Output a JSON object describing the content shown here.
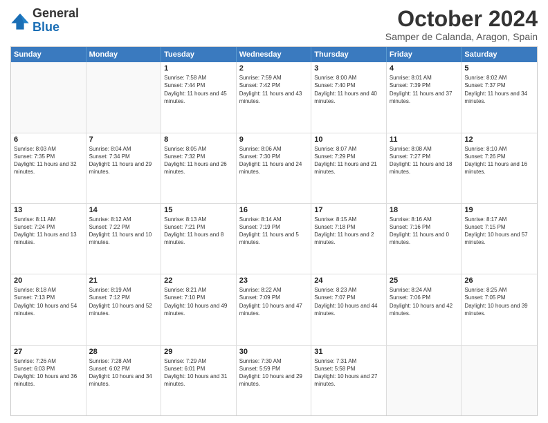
{
  "logo": {
    "general": "General",
    "blue": "Blue"
  },
  "title": "October 2024",
  "location": "Samper de Calanda, Aragon, Spain",
  "days_of_week": [
    "Sunday",
    "Monday",
    "Tuesday",
    "Wednesday",
    "Thursday",
    "Friday",
    "Saturday"
  ],
  "weeks": [
    [
      {
        "day": "",
        "info": ""
      },
      {
        "day": "",
        "info": ""
      },
      {
        "day": "1",
        "info": "Sunrise: 7:58 AM\nSunset: 7:44 PM\nDaylight: 11 hours and 45 minutes."
      },
      {
        "day": "2",
        "info": "Sunrise: 7:59 AM\nSunset: 7:42 PM\nDaylight: 11 hours and 43 minutes."
      },
      {
        "day": "3",
        "info": "Sunrise: 8:00 AM\nSunset: 7:40 PM\nDaylight: 11 hours and 40 minutes."
      },
      {
        "day": "4",
        "info": "Sunrise: 8:01 AM\nSunset: 7:39 PM\nDaylight: 11 hours and 37 minutes."
      },
      {
        "day": "5",
        "info": "Sunrise: 8:02 AM\nSunset: 7:37 PM\nDaylight: 11 hours and 34 minutes."
      }
    ],
    [
      {
        "day": "6",
        "info": "Sunrise: 8:03 AM\nSunset: 7:35 PM\nDaylight: 11 hours and 32 minutes."
      },
      {
        "day": "7",
        "info": "Sunrise: 8:04 AM\nSunset: 7:34 PM\nDaylight: 11 hours and 29 minutes."
      },
      {
        "day": "8",
        "info": "Sunrise: 8:05 AM\nSunset: 7:32 PM\nDaylight: 11 hours and 26 minutes."
      },
      {
        "day": "9",
        "info": "Sunrise: 8:06 AM\nSunset: 7:30 PM\nDaylight: 11 hours and 24 minutes."
      },
      {
        "day": "10",
        "info": "Sunrise: 8:07 AM\nSunset: 7:29 PM\nDaylight: 11 hours and 21 minutes."
      },
      {
        "day": "11",
        "info": "Sunrise: 8:08 AM\nSunset: 7:27 PM\nDaylight: 11 hours and 18 minutes."
      },
      {
        "day": "12",
        "info": "Sunrise: 8:10 AM\nSunset: 7:26 PM\nDaylight: 11 hours and 16 minutes."
      }
    ],
    [
      {
        "day": "13",
        "info": "Sunrise: 8:11 AM\nSunset: 7:24 PM\nDaylight: 11 hours and 13 minutes."
      },
      {
        "day": "14",
        "info": "Sunrise: 8:12 AM\nSunset: 7:22 PM\nDaylight: 11 hours and 10 minutes."
      },
      {
        "day": "15",
        "info": "Sunrise: 8:13 AM\nSunset: 7:21 PM\nDaylight: 11 hours and 8 minutes."
      },
      {
        "day": "16",
        "info": "Sunrise: 8:14 AM\nSunset: 7:19 PM\nDaylight: 11 hours and 5 minutes."
      },
      {
        "day": "17",
        "info": "Sunrise: 8:15 AM\nSunset: 7:18 PM\nDaylight: 11 hours and 2 minutes."
      },
      {
        "day": "18",
        "info": "Sunrise: 8:16 AM\nSunset: 7:16 PM\nDaylight: 11 hours and 0 minutes."
      },
      {
        "day": "19",
        "info": "Sunrise: 8:17 AM\nSunset: 7:15 PM\nDaylight: 10 hours and 57 minutes."
      }
    ],
    [
      {
        "day": "20",
        "info": "Sunrise: 8:18 AM\nSunset: 7:13 PM\nDaylight: 10 hours and 54 minutes."
      },
      {
        "day": "21",
        "info": "Sunrise: 8:19 AM\nSunset: 7:12 PM\nDaylight: 10 hours and 52 minutes."
      },
      {
        "day": "22",
        "info": "Sunrise: 8:21 AM\nSunset: 7:10 PM\nDaylight: 10 hours and 49 minutes."
      },
      {
        "day": "23",
        "info": "Sunrise: 8:22 AM\nSunset: 7:09 PM\nDaylight: 10 hours and 47 minutes."
      },
      {
        "day": "24",
        "info": "Sunrise: 8:23 AM\nSunset: 7:07 PM\nDaylight: 10 hours and 44 minutes."
      },
      {
        "day": "25",
        "info": "Sunrise: 8:24 AM\nSunset: 7:06 PM\nDaylight: 10 hours and 42 minutes."
      },
      {
        "day": "26",
        "info": "Sunrise: 8:25 AM\nSunset: 7:05 PM\nDaylight: 10 hours and 39 minutes."
      }
    ],
    [
      {
        "day": "27",
        "info": "Sunrise: 7:26 AM\nSunset: 6:03 PM\nDaylight: 10 hours and 36 minutes."
      },
      {
        "day": "28",
        "info": "Sunrise: 7:28 AM\nSunset: 6:02 PM\nDaylight: 10 hours and 34 minutes."
      },
      {
        "day": "29",
        "info": "Sunrise: 7:29 AM\nSunset: 6:01 PM\nDaylight: 10 hours and 31 minutes."
      },
      {
        "day": "30",
        "info": "Sunrise: 7:30 AM\nSunset: 5:59 PM\nDaylight: 10 hours and 29 minutes."
      },
      {
        "day": "31",
        "info": "Sunrise: 7:31 AM\nSunset: 5:58 PM\nDaylight: 10 hours and 27 minutes."
      },
      {
        "day": "",
        "info": ""
      },
      {
        "day": "",
        "info": ""
      }
    ]
  ]
}
